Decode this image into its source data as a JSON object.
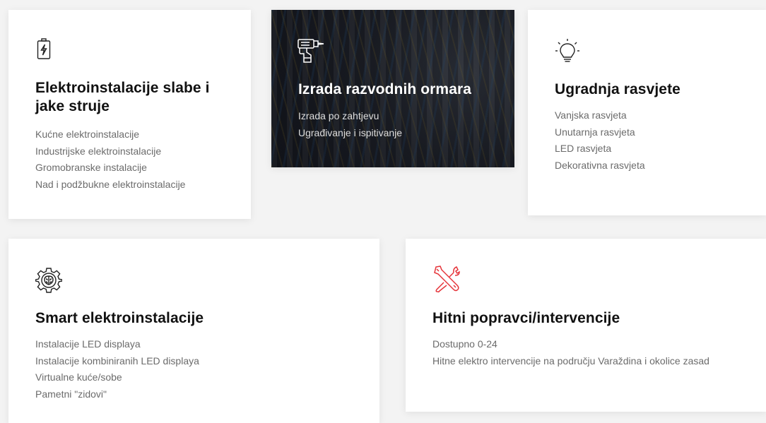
{
  "colors": {
    "background": "#f3f3f3",
    "card": "#ffffff",
    "title": "#111111",
    "text": "#6b6b6b",
    "accent_red": "#e5343a"
  },
  "cards": [
    {
      "icon": "battery-bolt-icon",
      "title": "Elektroinstalacije slabe i jake struje",
      "items": [
        "Kućne elektroinstalacije",
        "Industrijske elektroinstalacije",
        "Gromobranske instalacije",
        "Nad i podžbukne elektroinstalacije"
      ]
    },
    {
      "icon": "drill-icon",
      "title": "Izrada razvodnih ormara",
      "items": [
        "Izrada po zahtjevu",
        "Ugrađivanje i ispitivanje"
      ]
    },
    {
      "icon": "lightbulb-icon",
      "title": "Ugradnja rasvjete",
      "items": [
        "Vanjska rasvjeta",
        "Unutarnja rasvjeta",
        "LED rasvjeta",
        "Dekorativna rasvjeta"
      ]
    },
    {
      "icon": "gear-brain-icon",
      "title": "Smart elektroinstalacije",
      "items": [
        "Instalacije LED displaya",
        "Instalacije kombiniranih LED displaya",
        "Virtualne kuće/sobe",
        "Pametni \"zidovi\""
      ]
    },
    {
      "icon": "wrench-screwdriver-icon",
      "title": "Hitni popravci/intervencije",
      "items": [
        "Dostupno 0-24",
        "Hitne elektro intervencije na području Varaždina i okolice zasad"
      ]
    }
  ]
}
